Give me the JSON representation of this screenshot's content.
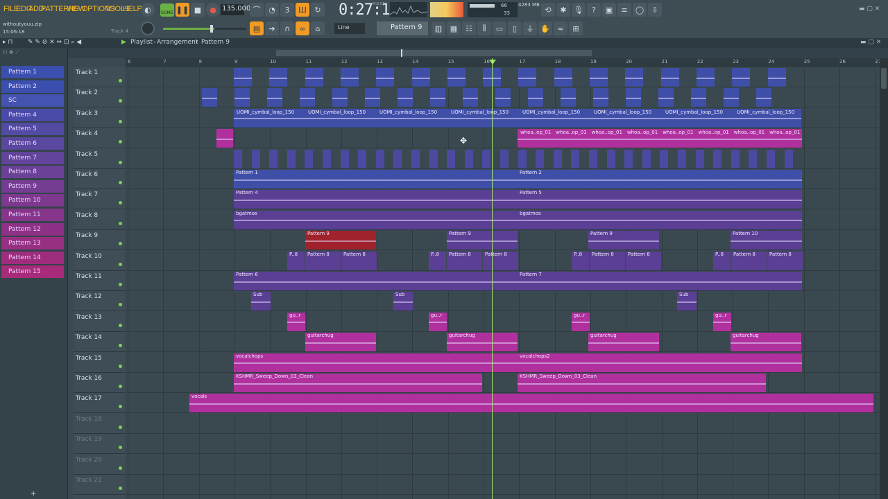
{
  "menu": [
    "FILE",
    "EDIT",
    "ADD",
    "PATTERNS",
    "VIEW",
    "OPTIONS",
    "TOOLS",
    "HELP"
  ],
  "transport": {
    "mode": "SONG",
    "tempo": "135.000",
    "time": "0:27:14",
    "time_unit": "M:S:CS",
    "cpu": "66",
    "memory": "4283 MB",
    "poly": "33"
  },
  "project": {
    "file": "withoutyouu.zip",
    "timestamp": "15:06:18",
    "hint": "Track 4"
  },
  "snap": "Line",
  "current_pattern": "Pattern 9",
  "breadcrumb": {
    "window": "Playlist",
    "view": "Arrangement",
    "pattern": "Pattern 9"
  },
  "patterns": [
    "Pattern 1",
    "Pattern 2",
    "SC",
    "Pattern 4",
    "Pattern 5",
    "Pattern 6",
    "Pattern 7",
    "Pattern 8",
    "Pattern 9",
    "Pattern 10",
    "Pattern 11",
    "Pattern 12",
    "Pattern 13",
    "Pattern 14",
    "Pattern 15"
  ],
  "tracks": [
    "Track 1",
    "Track 2",
    "Track 3",
    "Track 4",
    "Track 5",
    "Track 6",
    "Track 7",
    "Track 8",
    "Track 9",
    "Track 10",
    "Track 11",
    "Track 12",
    "Track 13",
    "Track 14",
    "Track 15",
    "Track 16",
    "Track 17",
    "Track 18",
    "Track 19",
    "Track 20",
    "Track 21"
  ],
  "ruler": [
    "6",
    "7",
    "8",
    "9",
    "10",
    "11",
    "12",
    "13",
    "14",
    "15",
    "16",
    "17",
    "18",
    "19",
    "20",
    "21",
    "22",
    "23",
    "24",
    "25",
    "26",
    "27"
  ],
  "clip_labels": {
    "t3": "UOMI_cymbal_loop_150",
    "t4": "whoa..op_01",
    "t6a": "Pattern 1",
    "t6b": "Pattern 2",
    "t7a": "Pattern 4",
    "t7b": "Pattern 5",
    "t8": "bgatmos",
    "t9": "Pattern 9",
    "t9b": "Pattern 10",
    "t10": "Pattern 8",
    "t10p": "P..8",
    "t11a": "Pattern 6",
    "t11b": "Pattern 7",
    "t12": "Sub",
    "t13": "gu..r",
    "t14": "guitarchug",
    "t15a": "vocalchops",
    "t15b": "vocalchops2",
    "t16": "KSHMR_Sweep_Down_03_Clean",
    "t17": "vocals"
  },
  "colors": {
    "accent": "#f29a26",
    "blue_clip": "#3f4fa8",
    "purple_clip": "#5a3f94",
    "magenta_clip": "#b0319e",
    "red_clip": "#a0222c",
    "playhead": "#a5e86b"
  }
}
